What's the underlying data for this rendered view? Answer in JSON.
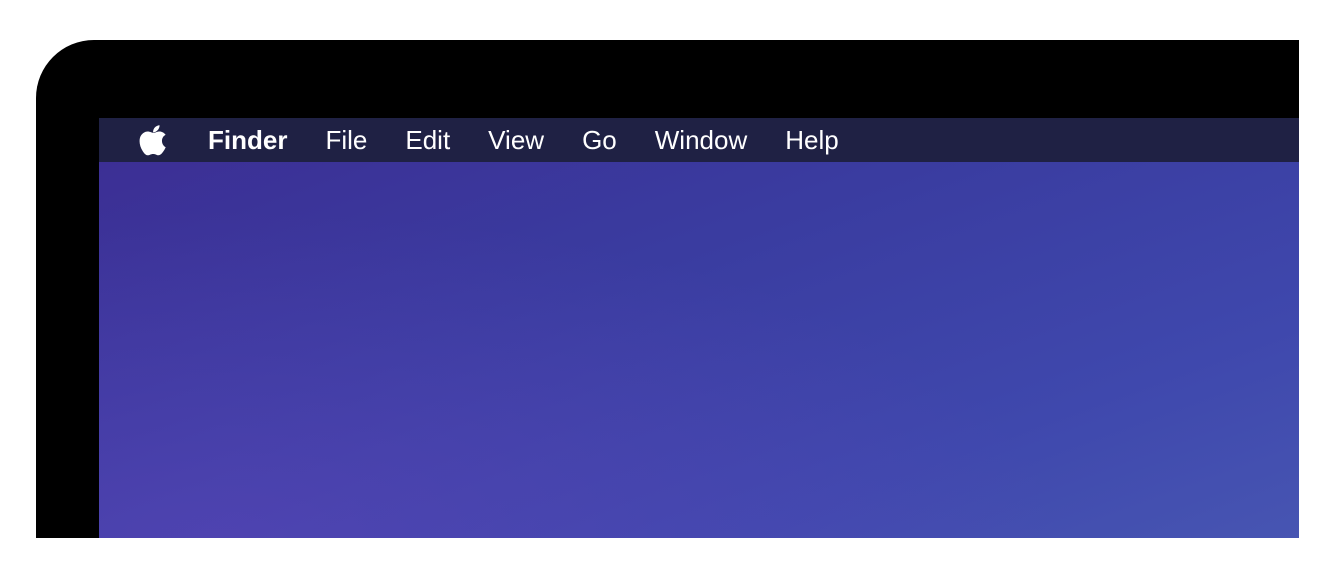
{
  "menubar": {
    "apple_icon": "apple-logo-icon",
    "app_name": "Finder",
    "items": [
      "File",
      "Edit",
      "View",
      "Go",
      "Window",
      "Help"
    ]
  },
  "colors": {
    "bezel": "#000000",
    "menubar_background": "#1f2144",
    "menubar_text": "#ffffff",
    "desktop_gradient_start": "#3c2d93",
    "desktop_gradient_end": "#4755b2"
  }
}
